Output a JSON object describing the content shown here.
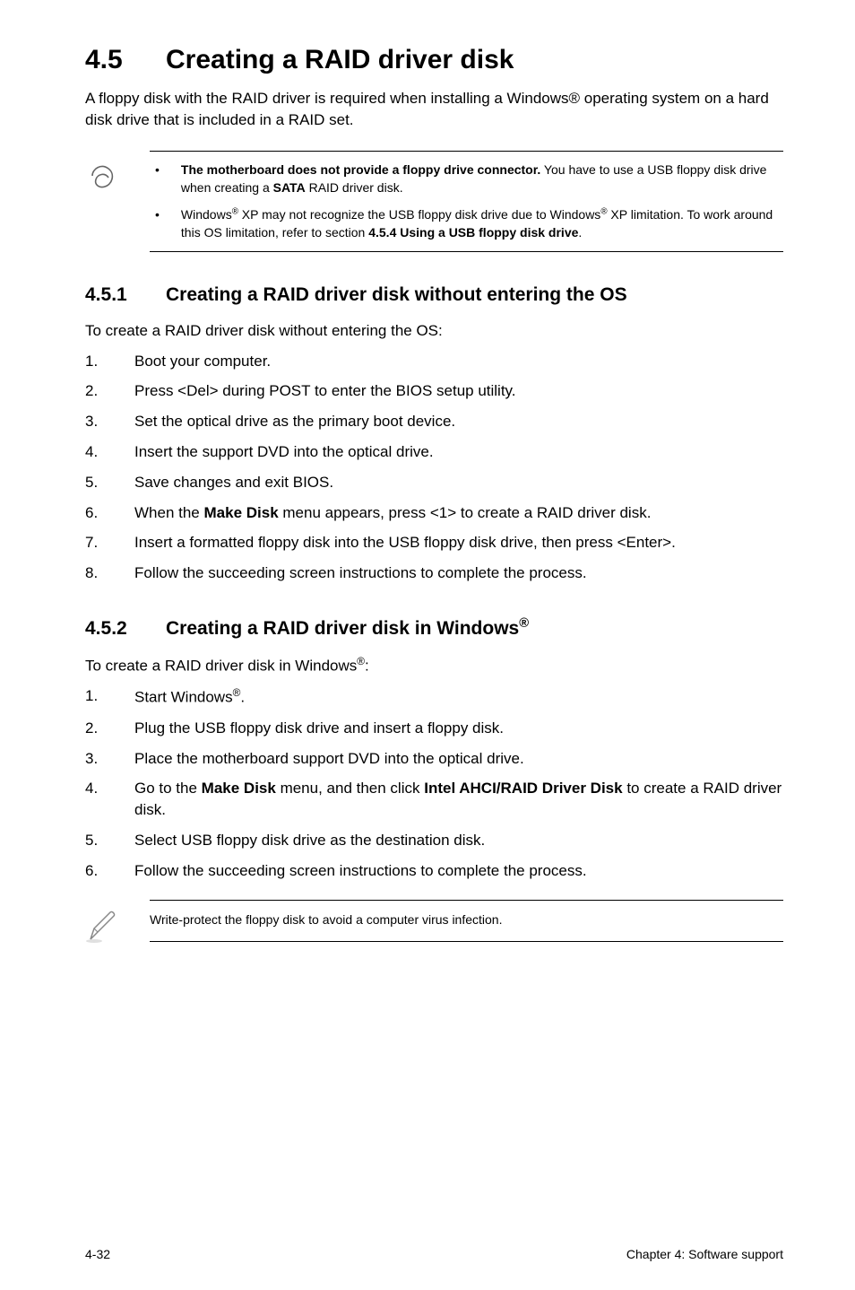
{
  "heading": {
    "number": "4.5",
    "title": "Creating a RAID driver disk"
  },
  "intro": "A floppy disk with the RAID driver is required when installing a Windows® operating system on a hard disk drive that is included in a RAID set.",
  "topNotes": [
    {
      "bold": "The motherboard does not provide a floppy drive connector.",
      "rest": " You have to use a USB floppy disk drive when creating a ",
      "bold2": "SATA",
      "rest2": " RAID driver disk."
    },
    {
      "text": "Windows® XP may not recognize the USB floppy disk drive due to Windows® XP limitation. To work around this OS limitation, refer to section ",
      "bold": "4.5.4 Using a USB floppy disk drive",
      "rest": "."
    }
  ],
  "section1": {
    "number": "4.5.1",
    "title": "Creating a RAID driver disk without entering the OS",
    "lead": "To create a RAID driver disk without entering the OS:",
    "steps": [
      "Boot your computer.",
      "Press <Del> during POST to enter the BIOS setup utility.",
      "Set the optical drive as the primary boot device.",
      "Insert the support DVD into the optical drive.",
      "Save changes and exit BIOS.",
      "When the <b>Make Disk</b> menu appears, press <1> to create a RAID driver disk.",
      "Insert a formatted floppy disk into the USB floppy disk drive, then press <Enter>.",
      "Follow the succeeding screen instructions to complete the process."
    ]
  },
  "section2": {
    "number": "4.5.2",
    "title_prefix": "Creating a RAID driver disk in Windows",
    "title_sup": "®",
    "lead": "To create a RAID driver disk in Windows®:",
    "steps": [
      "Start Windows®.",
      "Plug the USB floppy disk drive and insert a floppy disk.",
      "Place the motherboard support DVD into the optical drive.",
      "Go to the <b>Make Disk</b> menu, and then click <b>Intel AHCI/RAID Driver Disk</b> to create a RAID driver disk.",
      "Select USB floppy disk drive as the destination disk.",
      "Follow the succeeding screen instructions to complete the process."
    ]
  },
  "bottomNote": "Write-protect the floppy disk to avoid a computer virus infection.",
  "footer": {
    "left": "4-32",
    "right": "Chapter 4: Software support"
  }
}
